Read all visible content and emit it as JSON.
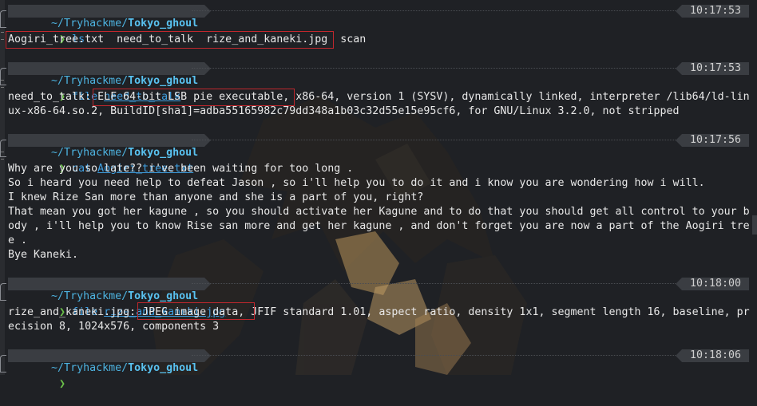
{
  "blocks": [
    {
      "path_prefix": "~/Tryhackme/",
      "project": "Tokyo_ghoul",
      "time": "10:17:53",
      "command": "ls",
      "args": "",
      "output": [
        "Aogiri_tree.txt  need_to_talk  rize_and_kaneki.jpg  scan"
      ]
    },
    {
      "path_prefix": "~/Tryhackme/",
      "project": "Tokyo_ghoul",
      "time": "10:17:53",
      "command": "file",
      "args": "need_to_talk",
      "output": [
        "need_to_talk: ELF 64-bit LSB pie executable, x86-64, version 1 (SYSV), dynamically linked, interpreter /lib64/ld-lin",
        "ux-x86-64.so.2, BuildID[sha1]=adba55165982c79dd348a1b03c32d55e15e95cf6, for GNU/Linux 3.2.0, not stripped"
      ]
    },
    {
      "path_prefix": "~/Tryhackme/",
      "project": "Tokyo_ghoul",
      "time": "10:17:56",
      "command": "cat",
      "args": "Aogiri_tree.txt",
      "output": [
        "Why are you so late?? i've been waiting for too long .",
        "So i heard you need help to defeat Jason , so i'll help you to do it and i know you are wondering how i will.",
        "I knew Rize San more than anyone and she is a part of you, right?",
        "That mean you got her kagune , so you should activate her Kagune and to do that you should get all control to your b",
        "ody , i'll help you to know Rise san more and get her kagune , and don't forget you are now a part of the Aogiri tre",
        "e .",
        "Bye Kaneki."
      ]
    },
    {
      "path_prefix": "~/Tryhackme/",
      "project": "Tokyo_ghoul",
      "time": "10:18:00",
      "command": "file",
      "args": "rize_and_kaneki.jpg",
      "output": [
        "rize_and_kaneki.jpg: JPEG image data, JFIF standard 1.01, aspect ratio, density 1x1, segment length 16, baseline, pr",
        "ecision 8, 1024x576, components 3"
      ]
    },
    {
      "path_prefix": "~/Tryhackme/",
      "project": "Tokyo_ghoul",
      "time": "10:18:06",
      "command": "",
      "args": "",
      "output": []
    }
  ],
  "prompt_symbol": "❯",
  "colors": {
    "background": "#1f2125",
    "segment": "#3a3d42",
    "path": "#4db3e0",
    "prompt": "#6cc24a",
    "command": "#3f9fe0",
    "highlight_box": "#c0272d"
  }
}
